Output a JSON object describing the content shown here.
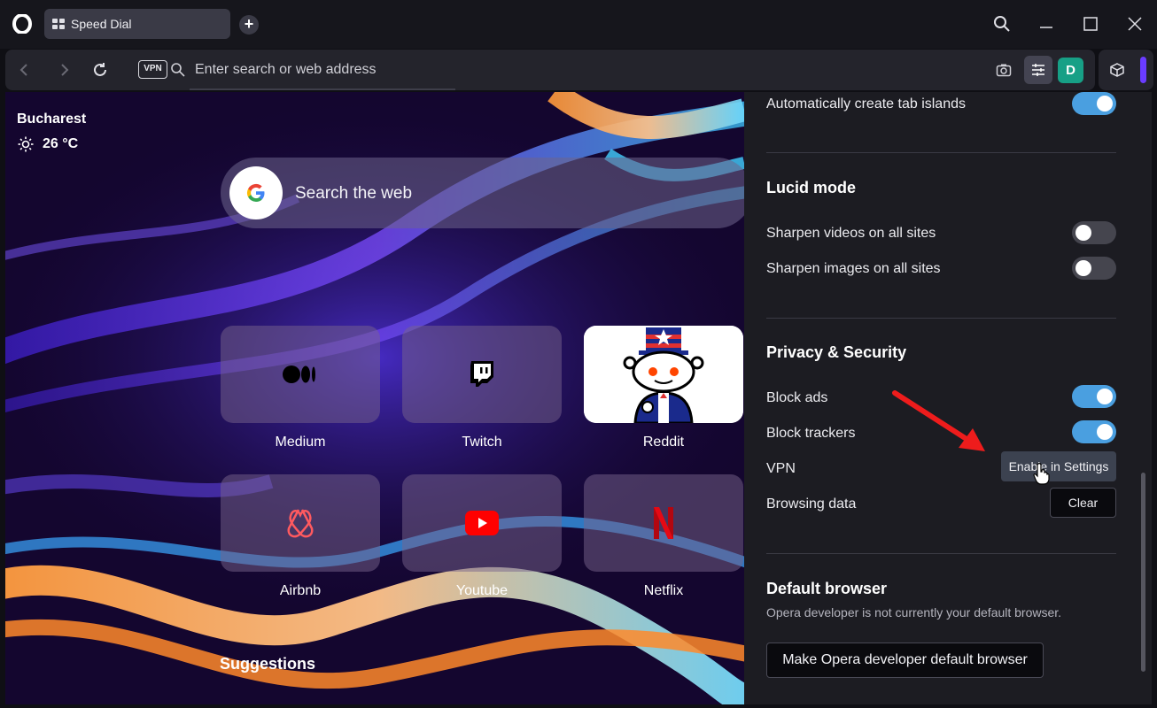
{
  "titlebar": {
    "tab_title": "Speed Dial",
    "new_tab_symbol": "+"
  },
  "toolbar": {
    "vpn_label": "VPN",
    "address_placeholder": "Enter search or web address",
    "profile_initial": "D",
    "profile_color": "#17a086",
    "accent_color": "#6a3cff"
  },
  "speed_dial": {
    "weather": {
      "city": "Bucharest",
      "temperature": "26 °C",
      "icon": "sun-icon"
    },
    "search": {
      "placeholder": "Search the web",
      "engine_icon": "google-icon"
    },
    "tiles": [
      {
        "label": "Medium",
        "icon": "medium-icon"
      },
      {
        "label": "Twitch",
        "icon": "twitch-icon"
      },
      {
        "label": "Reddit",
        "icon": "reddit-icon"
      },
      {
        "label": "Airbnb",
        "icon": "airbnb-icon"
      },
      {
        "label": "Youtube",
        "icon": "youtube-icon"
      },
      {
        "label": "Netflix",
        "icon": "netflix-icon"
      }
    ],
    "suggestions_heading": "Suggestions"
  },
  "easy_setup": {
    "tab_islands": {
      "label": "Automatically create tab islands",
      "enabled": true
    },
    "lucid_mode": {
      "title": "Lucid mode",
      "items": [
        {
          "label": "Sharpen videos on all sites",
          "enabled": false
        },
        {
          "label": "Sharpen images on all sites",
          "enabled": false
        }
      ]
    },
    "privacy": {
      "title": "Privacy & Security",
      "block_ads": {
        "label": "Block ads",
        "enabled": true
      },
      "block_trackers": {
        "label": "Block trackers",
        "enabled": true
      },
      "vpn": {
        "label": "VPN",
        "button": "Enable in Settings"
      },
      "browsing_data": {
        "label": "Browsing data",
        "button": "Clear"
      }
    },
    "default_browser": {
      "title": "Default browser",
      "description": "Opera developer is not currently your default browser.",
      "button": "Make Opera developer default browser"
    },
    "toggle_on_color": "#4a9fe0"
  }
}
